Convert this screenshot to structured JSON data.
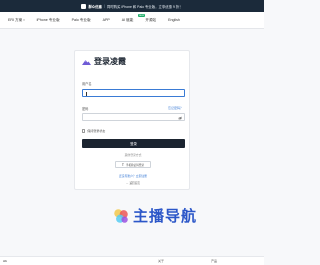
{
  "banner": {
    "brand": "群众优惠",
    "notice": "同时购买 iPhone 和 Palo 专业版，立享优惠 9 折！"
  },
  "nav": {
    "items": [
      {
        "label": "ERI 方案",
        "caret": "▾"
      },
      {
        "label": "iPhone 专业版"
      },
      {
        "label": "Palo 专业版"
      },
      {
        "label": "APP"
      },
      {
        "label": "AI 赋能",
        "badge": "NEW"
      },
      {
        "label": "开源站"
      },
      {
        "label": "English"
      }
    ]
  },
  "login": {
    "title": "登录凌霞",
    "username_label": "用户名",
    "username_value": "",
    "password_label": "密码",
    "forgot_label": "忘记密码？",
    "password_value": "",
    "remember_label": "保持登录状态",
    "login_button": "登录",
    "other_methods": "其他登录方式",
    "other_method_button": "手机验证码登录",
    "register_text": "还没有账户？立即注册",
    "back_link": "← 返回首页"
  },
  "watermark": {
    "text": "主播导航"
  },
  "footer": {
    "left_text": "Ah",
    "col1": "关于",
    "col2": "产品"
  },
  "colors": {
    "banner_bg": "#1b2a3a",
    "primary_button": "#1b2430",
    "link": "#3a7bd5",
    "badge": "#1fae6a",
    "watermark": "#2b56c8"
  },
  "icons": {
    "logo": "mountain-logo-icon",
    "eye": "eye-icon",
    "phone": "phone-icon"
  }
}
